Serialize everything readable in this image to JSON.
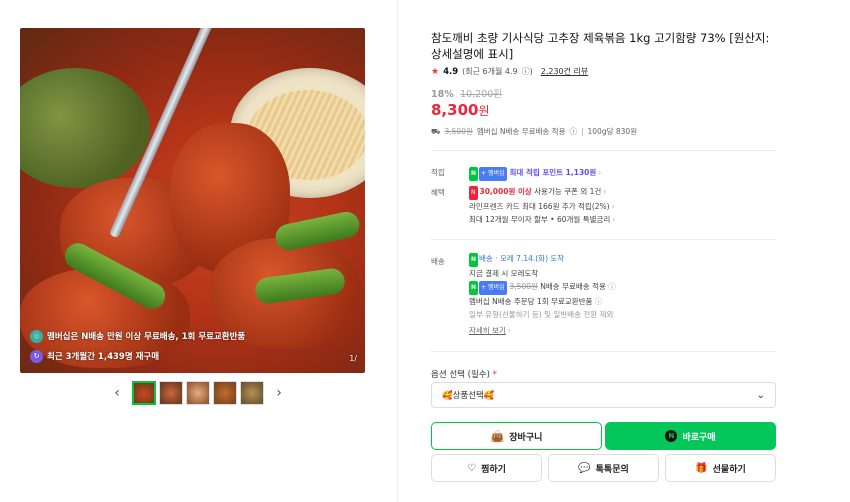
{
  "gallery": {
    "badge_1": "멤버십은 N배송 만원 이상 무료배송, 1회 무료교환반품",
    "badge_2": "최근 3개월간 1,439명 재구매",
    "pager": "1/",
    "prev_icon": "chevron-left-icon",
    "next_icon": "chevron-right-icon"
  },
  "product": {
    "title": "참도깨비 초량 기사식당 고추장 제육볶음 1kg 고기함량 73% [원산지:상세설명에 표시]",
    "rating": "4.9",
    "rating_detail": "(최근 6개월 4.9",
    "reviews": "2,230건 리뷰",
    "discount_rate": "18%",
    "original_price": "10,200원",
    "price": "8,300",
    "price_unit": "원",
    "ship_original": "3,500원",
    "ship_text": "멤버십 N배송 무료배송 적용",
    "unit_price": "100g당 830원"
  },
  "benefits": {
    "points_label": "적립",
    "points_text": "최대 적립 포인트 1,130원",
    "perks_label": "혜택",
    "perk_1_amount": "30,000원 이상",
    "perk_1_text": "사용가능 쿠폰 외 1건",
    "perk_2": "라인프렌즈 카드 최대 166원 추가 적립(2%)",
    "perk_3": "최대 12개월 무이자 할부 • 60개월 특별금리"
  },
  "shipping": {
    "label": "배송",
    "eta": "배송 · 모레 7.14.(화) 도착",
    "line_1": "지금 결제 시 모레도착",
    "line_2_original": "3,500원",
    "line_2": "N배송 무료배송 적용",
    "line_3": "멤버십 N배송 주문당 1회 무료교환반품",
    "line_4": "일부 유형(선물하기 등) 및 일반배송 전환 제외",
    "more": "자세히 보기"
  },
  "options": {
    "label": "옵션 선택 (필수)",
    "required_mark": "*",
    "select_value": "🥰상품선택🥰"
  },
  "actions": {
    "cart": "장바구니",
    "buy": "바로구매",
    "wish": "찜하기",
    "talk": "톡톡문의",
    "gift": "선물하기"
  },
  "colors": {
    "accent_green": "#03c75a",
    "price_red": "#f0243a",
    "points_purple": "#5d4ef0"
  }
}
